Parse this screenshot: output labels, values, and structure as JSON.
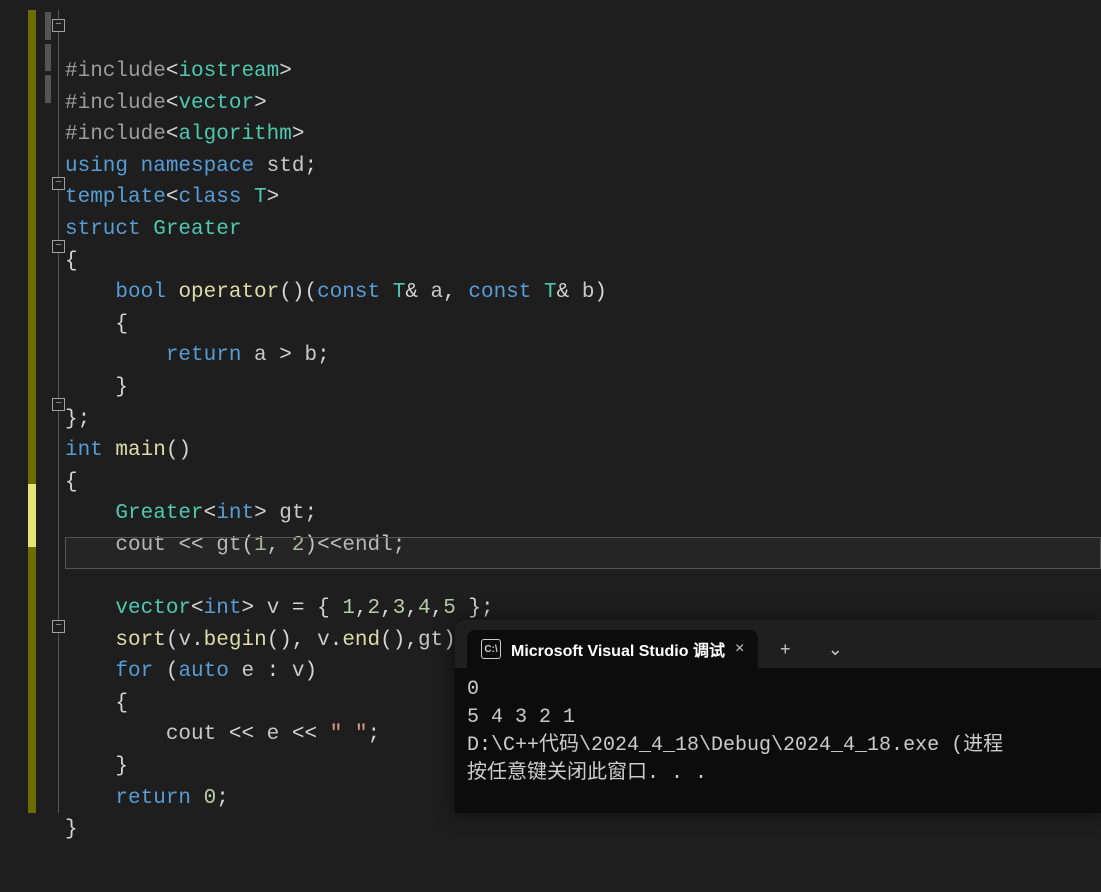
{
  "code": {
    "lines": [
      {
        "fold": "minus",
        "mod": true,
        "tokens": [
          [
            "pp",
            "#include"
          ],
          [
            "angle",
            "<"
          ],
          [
            "type",
            "iostream"
          ],
          [
            "angle",
            ">"
          ]
        ]
      },
      {
        "mod": true,
        "tokens": [
          [
            "pp",
            "#include"
          ],
          [
            "angle",
            "<"
          ],
          [
            "type",
            "vector"
          ],
          [
            "angle",
            ">"
          ]
        ]
      },
      {
        "mod": true,
        "tokens": [
          [
            "pp",
            "#include"
          ],
          [
            "angle",
            "<"
          ],
          [
            "type",
            "algorithm"
          ],
          [
            "angle",
            ">"
          ]
        ]
      },
      {
        "tokens": [
          [
            "kw",
            "using "
          ],
          [
            "kw",
            "namespace "
          ],
          [
            "ident",
            "std"
          ],
          [
            "punct",
            ";"
          ]
        ]
      },
      {
        "tokens": [
          [
            "kw",
            "template"
          ],
          [
            "angle",
            "<"
          ],
          [
            "kw",
            "class "
          ],
          [
            "type",
            "T"
          ],
          [
            "angle",
            ">"
          ]
        ]
      },
      {
        "fold": "minus",
        "tokens": [
          [
            "kw",
            "struct "
          ],
          [
            "type",
            "Greater"
          ]
        ]
      },
      {
        "tokens": [
          [
            "punct",
            "{"
          ]
        ]
      },
      {
        "fold": "minus",
        "indent": 1,
        "tokens": [
          [
            "kw",
            "bool "
          ],
          [
            "func",
            "operator"
          ],
          [
            "punct",
            "()("
          ],
          [
            "kw",
            "const "
          ],
          [
            "type",
            "T"
          ],
          [
            "punct",
            "& "
          ],
          [
            "ident",
            "a"
          ],
          [
            "punct",
            ", "
          ],
          [
            "kw",
            "const "
          ],
          [
            "type",
            "T"
          ],
          [
            "punct",
            "& "
          ],
          [
            "ident",
            "b"
          ],
          [
            "punct",
            ")"
          ]
        ]
      },
      {
        "indent": 1,
        "tokens": [
          [
            "punct",
            "{"
          ]
        ]
      },
      {
        "indent": 2,
        "tokens": [
          [
            "kw",
            "return "
          ],
          [
            "ident",
            "a"
          ],
          [
            "punct",
            " > "
          ],
          [
            "ident",
            "b"
          ],
          [
            "punct",
            ";"
          ]
        ]
      },
      {
        "indent": 1,
        "tokens": [
          [
            "punct",
            "}"
          ]
        ]
      },
      {
        "tokens": [
          [
            "punct",
            "};"
          ]
        ]
      },
      {
        "fold": "minus",
        "tokens": [
          [
            "kw",
            "int "
          ],
          [
            "func",
            "main"
          ],
          [
            "punct",
            "()"
          ]
        ]
      },
      {
        "tokens": [
          [
            "punct",
            "{"
          ]
        ]
      },
      {
        "indent": 1,
        "tokens": [
          [
            "type",
            "Greater"
          ],
          [
            "angle",
            "<"
          ],
          [
            "kw",
            "int"
          ],
          [
            "angle",
            "> "
          ],
          [
            "ident",
            "gt"
          ],
          [
            "punct",
            ";"
          ]
        ]
      },
      {
        "indent": 1,
        "yellow": true,
        "tokens": [
          [
            "ident",
            "cout"
          ],
          [
            "punct",
            " << "
          ],
          [
            "ident",
            "gt"
          ],
          [
            "punct",
            "("
          ],
          [
            "num",
            "1"
          ],
          [
            "punct",
            ", "
          ],
          [
            "num",
            "2"
          ],
          [
            "punct",
            ")<<"
          ],
          [
            "ident",
            "endl"
          ],
          [
            "punct",
            ";"
          ]
        ]
      },
      {
        "yellow": true,
        "tokens": [
          [
            "punct",
            ""
          ]
        ]
      },
      {
        "indent": 1,
        "highlight": true,
        "tokens": [
          [
            "type",
            "vector"
          ],
          [
            "angle",
            "<"
          ],
          [
            "kw",
            "int"
          ],
          [
            "angle",
            "> "
          ],
          [
            "ident",
            "v"
          ],
          [
            "punct",
            " = { "
          ],
          [
            "num",
            "1"
          ],
          [
            "punct",
            ","
          ],
          [
            "num",
            "2"
          ],
          [
            "punct",
            ","
          ],
          [
            "num",
            "3"
          ],
          [
            "punct",
            ","
          ],
          [
            "num",
            "4"
          ],
          [
            "punct",
            ","
          ],
          [
            "num",
            "5"
          ],
          [
            "punct",
            " };"
          ]
        ]
      },
      {
        "indent": 1,
        "tokens": [
          [
            "func",
            "sort"
          ],
          [
            "punct",
            "("
          ],
          [
            "ident",
            "v"
          ],
          [
            "punct",
            "."
          ],
          [
            "func",
            "begin"
          ],
          [
            "punct",
            "(), "
          ],
          [
            "ident",
            "v"
          ],
          [
            "punct",
            "."
          ],
          [
            "func",
            "end"
          ],
          [
            "punct",
            "(),"
          ],
          [
            "ident",
            "gt"
          ],
          [
            "punct",
            ");"
          ]
        ]
      },
      {
        "fold": "minus",
        "indent": 1,
        "tokens": [
          [
            "kw",
            "for "
          ],
          [
            "punct",
            "("
          ],
          [
            "kw",
            "auto "
          ],
          [
            "ident",
            "e"
          ],
          [
            "punct",
            " : "
          ],
          [
            "ident",
            "v"
          ],
          [
            "punct",
            ")"
          ]
        ]
      },
      {
        "indent": 1,
        "tokens": [
          [
            "punct",
            "{"
          ]
        ]
      },
      {
        "indent": 2,
        "tokens": [
          [
            "ident",
            "cout"
          ],
          [
            "punct",
            " << "
          ],
          [
            "ident",
            "e"
          ],
          [
            "punct",
            " << "
          ],
          [
            "str",
            "\" \""
          ],
          [
            "punct",
            ";"
          ]
        ]
      },
      {
        "indent": 1,
        "tokens": [
          [
            "punct",
            "}"
          ]
        ]
      },
      {
        "indent": 1,
        "tokens": [
          [
            "kw",
            "return "
          ],
          [
            "num",
            "0"
          ],
          [
            "punct",
            ";"
          ]
        ]
      },
      {
        "tokens": [
          [
            "punct",
            "}"
          ]
        ]
      }
    ]
  },
  "terminal": {
    "tab_title": "Microsoft Visual Studio 调试",
    "output": [
      "0",
      "5 4 3 2 1",
      "D:\\C++代码\\2024_4_18\\Debug\\2024_4_18.exe (进程",
      "按任意键关闭此窗口. . ."
    ]
  },
  "icons": {
    "close": "×",
    "plus": "+",
    "chevron": "⌄",
    "term": "C:\\"
  }
}
